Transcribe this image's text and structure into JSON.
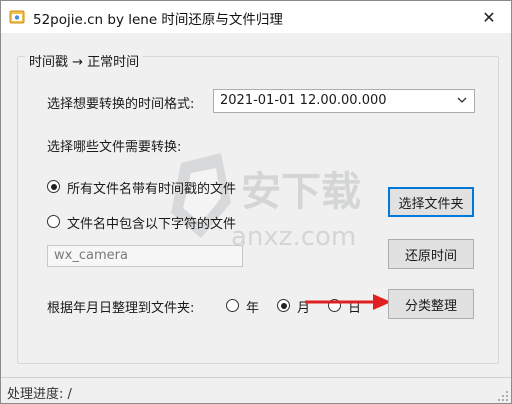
{
  "window": {
    "title": "52pojie.cn by lene 时间还原与文件归理",
    "close_glyph": "✕"
  },
  "group": {
    "title": "时间戳 → 正常时间"
  },
  "format": {
    "label": "选择想要转换的时间格式:",
    "selected": "2021-01-01 12.00.00.000"
  },
  "files": {
    "label": "选择哪些文件需要转换:",
    "option_all": "所有文件名带有时间戳的文件",
    "option_contains": "文件名中包含以下字符的文件",
    "filter_value": "wx_camera"
  },
  "buttons": {
    "select_folder": "选择文件夹",
    "restore_time": "还原时间",
    "classify": "分类整理"
  },
  "organize": {
    "label": "根据年月日整理到文件夹:",
    "year": "年",
    "month": "月",
    "day": "日"
  },
  "status": {
    "text": "处理进度: /"
  },
  "watermark": {
    "text": "安下载",
    "domain": "anxz.com"
  },
  "colors": {
    "accent": "#0078d7",
    "annotation_arrow": "#e02020"
  }
}
